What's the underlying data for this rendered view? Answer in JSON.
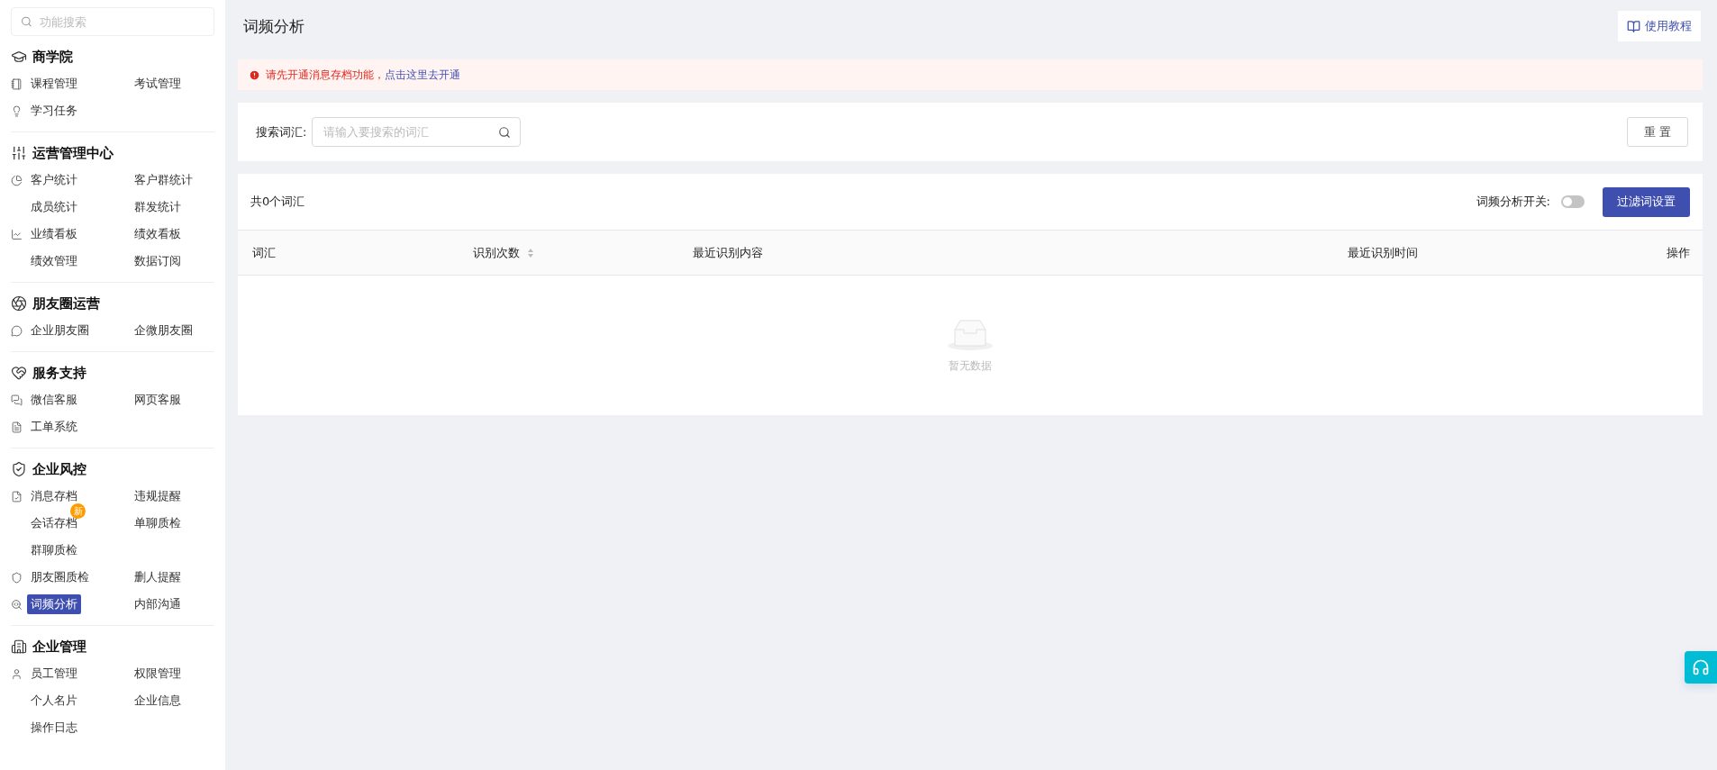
{
  "sidebar": {
    "search": {
      "placeholder": "功能搜索"
    },
    "sections": [
      {
        "title": "商学院",
        "rows": [
          [
            {
              "label": "课程管理",
              "selected": false
            },
            {
              "label": "考试管理",
              "selected": false
            }
          ],
          [
            {
              "label": "学习任务",
              "selected": false
            }
          ]
        ]
      },
      {
        "title": "运营管理中心",
        "rows": [
          [
            {
              "label": "客户统计",
              "selected": false
            },
            {
              "label": "客户群统计",
              "selected": false
            }
          ],
          [
            {
              "label": "成员统计",
              "selected": false
            },
            {
              "label": "群发统计",
              "selected": false
            }
          ],
          [
            {
              "label": "业绩看板",
              "selected": false
            },
            {
              "label": "绩效看板",
              "selected": false
            }
          ],
          [
            {
              "label": "绩效管理",
              "selected": false
            },
            {
              "label": "数据订阅",
              "selected": false
            }
          ]
        ]
      },
      {
        "title": "朋友圈运营",
        "rows": [
          [
            {
              "label": "企业朋友圈",
              "selected": false
            },
            {
              "label": "企微朋友圈",
              "selected": false
            }
          ]
        ]
      },
      {
        "title": "服务支持",
        "rows": [
          [
            {
              "label": "微信客服",
              "selected": false
            },
            {
              "label": "网页客服",
              "selected": false
            }
          ],
          [
            {
              "label": "工单系统",
              "selected": false
            }
          ]
        ]
      },
      {
        "title": "企业风控",
        "rows": [
          [
            {
              "label": "消息存档",
              "selected": false
            },
            {
              "label": "违规提醒",
              "selected": false
            }
          ],
          [
            {
              "label": "会话存档",
              "selected": false,
              "badge": "新"
            },
            {
              "label": "单聊质检",
              "selected": false
            }
          ],
          [
            {
              "label": "群聊质检",
              "selected": false
            }
          ],
          [
            {
              "label": "朋友圈质检",
              "selected": false
            },
            {
              "label": "删人提醒",
              "selected": false
            }
          ],
          [
            {
              "label": "词频分析",
              "selected": true
            },
            {
              "label": "内部沟通",
              "selected": false
            }
          ]
        ]
      },
      {
        "title": "企业管理",
        "rows": [
          [
            {
              "label": "员工管理",
              "selected": false
            },
            {
              "label": "权限管理",
              "selected": false
            }
          ],
          [
            {
              "label": "个人名片",
              "selected": false
            },
            {
              "label": "企业信息",
              "selected": false
            }
          ],
          [
            {
              "label": "操作日志",
              "selected": false
            }
          ]
        ]
      }
    ]
  },
  "page": {
    "title": "词频分析",
    "tutorial_button": "使用教程"
  },
  "alert": {
    "message": "请先开通消息存档功能，",
    "link": "点击这里去开通"
  },
  "filter": {
    "label": "搜索词汇:",
    "placeholder": "请输入要搜索的词汇",
    "reset_button": "重 置"
  },
  "table": {
    "count": "共0个词汇",
    "switch": {
      "label": "词频分析开关:",
      "on": false
    },
    "filter_button": "过滤词设置",
    "columns": [
      {
        "label": "词汇",
        "sortable": false
      },
      {
        "label": "识别次数",
        "sortable": true
      },
      {
        "label": "最近识别内容",
        "sortable": false
      },
      {
        "label": "最近识别时间",
        "sortable": false
      },
      {
        "label": "操作",
        "sortable": false
      }
    ],
    "empty_text": "暂无数据"
  }
}
